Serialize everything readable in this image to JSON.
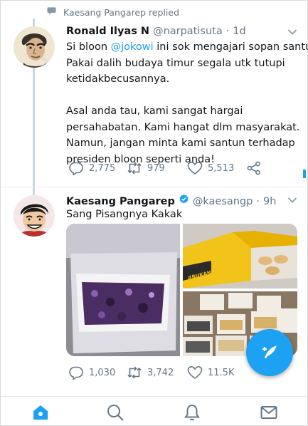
{
  "reply_context": {
    "text": "Kaesang Pangarep replied"
  },
  "tweet1": {
    "name": "Ronald Ilyas N",
    "handle": "@narpatisuta",
    "separator": "·",
    "time": "1d",
    "lines": [
      {
        "before": "Si bloon ",
        "mention": "@jokowi",
        "after": " ini sok mengajari sopan santun."
      },
      {
        "text": "Pakai dalih budaya timur segala utk tutupi"
      },
      {
        "text": "ketidakbecusannya."
      },
      {
        "text": ""
      },
      {
        "text": "Asal anda tau, kami sangat hargai"
      },
      {
        "text": "persahabatan. Kami hangat dlm masyarakat."
      },
      {
        "text": "Namun, jangan minta kami santun terhadap"
      },
      {
        "text": "presiden bloon seperti anda!"
      }
    ],
    "replies": "2,775",
    "retweets": "979",
    "likes": "5,513"
  },
  "tweet2": {
    "name": "Kaesang Pangarep",
    "handle": "@kaesangp",
    "separator": "·",
    "time": "9h",
    "text": "Sang Pisangnya Kakak",
    "media_sign_text": "#BUKANKUEARTIS",
    "replies": "1,030",
    "retweets": "3,742",
    "likes": "11.5K"
  },
  "icons": {
    "reply_context": "speech-bubble-icon",
    "reply": "reply-icon",
    "retweet": "retweet-icon",
    "like": "heart-icon",
    "share": "share-icon",
    "compose": "compose-tweet-icon",
    "home": "home-icon",
    "search": "search-icon",
    "notifications": "bell-icon",
    "messages": "envelope-icon"
  },
  "colors": {
    "accent": "#1da1f2",
    "text": "#14171a",
    "secondary": "#657786",
    "divider": "#e6ecf0"
  }
}
